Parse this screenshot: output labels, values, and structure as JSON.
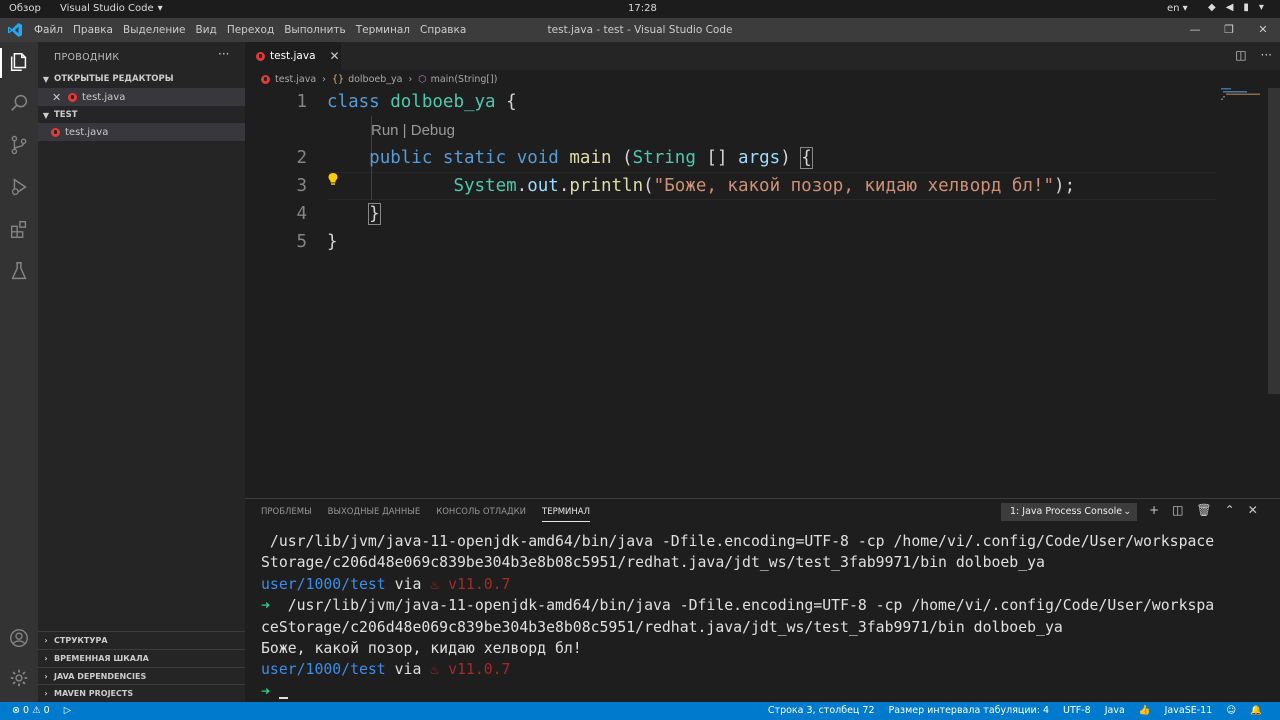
{
  "system_bar": {
    "overview": "Обзор",
    "app": "Visual Studio Code",
    "clock": "17:28",
    "lang": "en"
  },
  "menu": {
    "items": [
      "Файл",
      "Правка",
      "Выделение",
      "Вид",
      "Переход",
      "Выполнить",
      "Терминал",
      "Справка"
    ],
    "window_title": "test.java - test - Visual Studio Code"
  },
  "sidebar": {
    "title": "ПРОВОДНИК",
    "open_editors_header": "ОТКРЫТЫЕ РЕДАКТОРЫ",
    "open_editor_file": "test.java",
    "folder_header": "TEST",
    "folder_file": "test.java",
    "bottom_sections": [
      "СТРУКТУРА",
      "ВРЕМЕННАЯ ШКАЛА",
      "JAVA DEPENDENCIES",
      "MAVEN PROJECTS"
    ]
  },
  "editor": {
    "tab_label": "test.java",
    "breadcrumb": {
      "file": "test.java",
      "class": "dolboeb_ya",
      "method": "main(String[])"
    },
    "codelens": "Run | Debug",
    "line_numbers": [
      "1",
      "2",
      "3",
      "4",
      "5"
    ],
    "lines": {
      "l1_kw": "class",
      "l1_name": "dolboeb_ya",
      "l1_brace": "{",
      "l2_public": "public",
      "l2_static": "static",
      "l2_void": "void",
      "l2_main": "main",
      "l2_open": "(",
      "l2_string": "String",
      "l2_arr": "[]",
      "l2_args": "args",
      "l2_close": ")",
      "l2_brace": "{",
      "l3_system": "System",
      "l3_dot1": ".",
      "l3_out": "out",
      "l3_dot2": ".",
      "l3_println": "println",
      "l3_open": "(",
      "l3_str": "\"Боже, какой позор, кидаю хелворд бл!\"",
      "l3_end": ");",
      "l4_brace": "}",
      "l5_brace": "}"
    }
  },
  "panel": {
    "tabs": [
      "ПРОБЛЕМЫ",
      "ВЫХОДНЫЕ ДАННЫЕ",
      "КОНСОЛЬ ОТЛАДКИ",
      "ТЕРМИНАЛ"
    ],
    "terminal_select": "1: Java Process Console",
    "terminal": {
      "line1": " /usr/lib/jvm/java-11-openjdk-amd64/bin/java -Dfile.encoding=UTF-8 -cp /home/vi/.config/Code/User/workspace",
      "line2": "Storage/c206d48e069c839be304b3e8b08c5951/redhat.java/jdt_ws/test_3fab9971/bin dolboeb_ya",
      "prompt_path": "user/1000/test",
      "prompt_via": " via ",
      "prompt_ver": " v11.0.7",
      "arrow": "➜",
      "line4": "  /usr/lib/jvm/java-11-openjdk-amd64/bin/java -Dfile.encoding=UTF-8 -cp /home/vi/.config/Code/User/workspa",
      "line5": "ceStorage/c206d48e069c839be304b3e8b08c5951/redhat.java/jdt_ws/test_3fab9971/bin dolboeb_ya",
      "output": "Боже, какой позор, кидаю хелворд бл!"
    }
  },
  "status_bar": {
    "errors": "0",
    "warnings": "0",
    "position": "Строка 3, столбец 72",
    "tab_size": "Размер интервала табуляции: 4",
    "encoding": "UTF-8",
    "language": "Java",
    "runtime": "JavaSE-11"
  },
  "colors": {
    "accent": "#007acc",
    "keyword": "#569cd6",
    "type": "#4ec9b0",
    "function": "#dcdcaa",
    "string": "#ce9178",
    "variable": "#9cdcfe"
  }
}
